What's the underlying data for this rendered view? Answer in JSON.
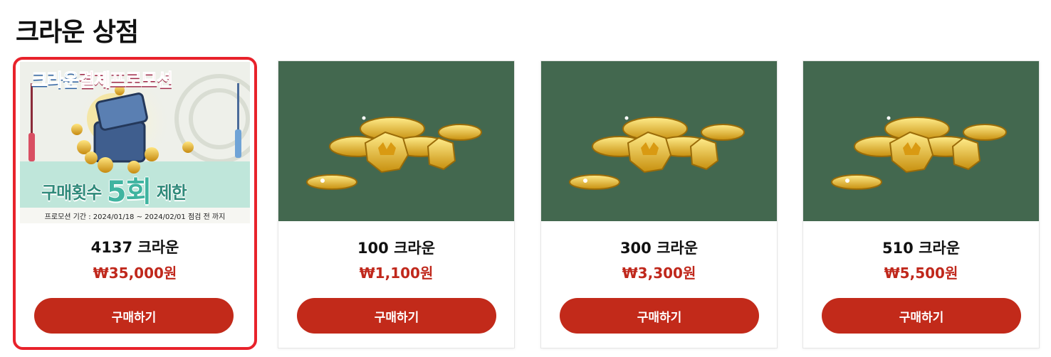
{
  "page": {
    "title": "크라운 상점"
  },
  "promo_banner": {
    "heading_part1": "크라운",
    "heading_part2": "결제프로모션",
    "limit_prefix": "구매횟수",
    "limit_count": "5회",
    "limit_suffix": "제한",
    "period": "프로모션 기간 : 2024/01/18 ~ 2024/02/01 점검 전 까지"
  },
  "products": [
    {
      "name": "4137 크라운",
      "price": "₩35,000원",
      "button": "구매하기"
    },
    {
      "name": "100 크라운",
      "price": "₩1,100원",
      "button": "구매하기"
    },
    {
      "name": "300 크라운",
      "price": "₩3,300원",
      "button": "구매하기"
    },
    {
      "name": "510 크라운",
      "price": "₩5,500원",
      "button": "구매하기"
    }
  ],
  "colors": {
    "button": "#c22a1a",
    "price": "#c0281c",
    "highlight_border": "#e8222b",
    "image_background": "#43684f"
  }
}
